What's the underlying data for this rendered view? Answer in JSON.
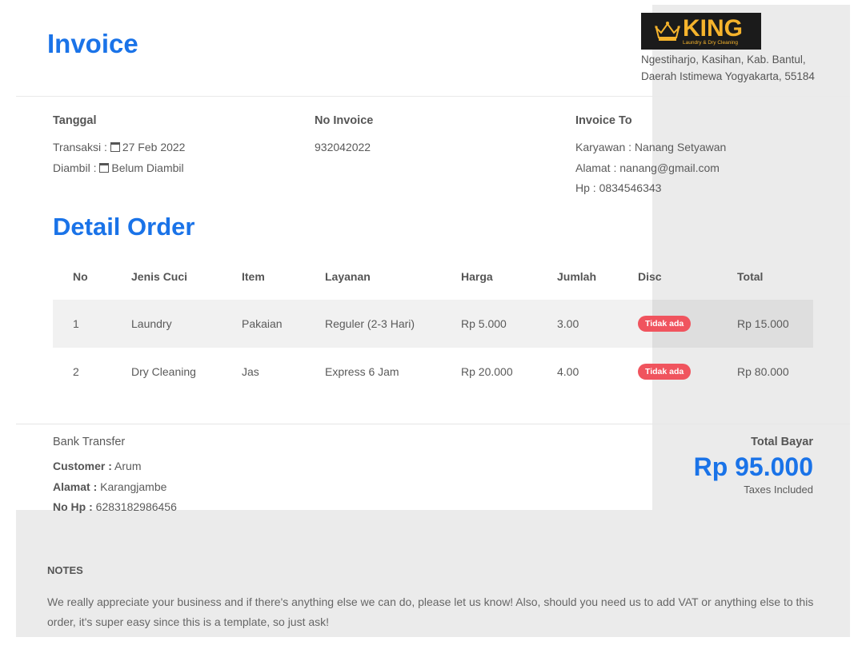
{
  "invoice": {
    "title": "Invoice",
    "logo": {
      "name": "KING",
      "tagline": "Laundry & Dry Cleaning"
    },
    "address": {
      "line1": "Ngestiharjo, Kasihan, Kab. Bantul,",
      "line2": "Daerah Istimewa Yogyakarta, 55184"
    },
    "tanggal": {
      "heading": "Tanggal",
      "transaksi_label": "Transaksi :",
      "transaksi_value": "27 Feb 2022",
      "diambil_label": "Diambil :",
      "diambil_value": "Belum Diambil"
    },
    "no_invoice": {
      "heading": "No Invoice",
      "value": "932042022"
    },
    "invoice_to": {
      "heading": "Invoice To",
      "karyawan": "Karyawan : Nanang Setyawan",
      "alamat": "Alamat : nanang@gmail.com",
      "hp": "Hp : 0834546343"
    }
  },
  "order": {
    "title": "Detail Order",
    "columns": [
      "No",
      "Jenis Cuci",
      "Item",
      "Layanan",
      "Harga",
      "Jumlah",
      "Disc",
      "Total"
    ],
    "rows": [
      {
        "no": "1",
        "jenis": "Laundry",
        "item": "Pakaian",
        "layanan": "Reguler (2-3 Hari)",
        "harga": "Rp 5.000",
        "jumlah": "3.00",
        "disc": "Tidak ada",
        "total": "Rp 15.000"
      },
      {
        "no": "2",
        "jenis": "Dry Cleaning",
        "item": "Jas",
        "layanan": "Express 6 Jam",
        "harga": "Rp 20.000",
        "jumlah": "4.00",
        "disc": "Tidak ada",
        "total": "Rp 80.000"
      }
    ]
  },
  "payment": {
    "method": "Bank Transfer",
    "customer_label": "Customer :",
    "customer_value": "Arum",
    "alamat_label": "Alamat :",
    "alamat_value": "Karangjambe",
    "hp_label": "No Hp :",
    "hp_value": "6283182986456"
  },
  "total": {
    "label": "Total Bayar",
    "amount": "Rp 95.000",
    "note": "Taxes Included"
  },
  "notes": {
    "heading": "NOTES",
    "text": "We really appreciate your business and if there's anything else we can do, please let us know! Also, should you need us to add VAT or anything else to this order, it's super easy since this is a template, so just ask!"
  },
  "colors": {
    "accent": "#1a73e8",
    "badge": "#f0545e",
    "logo_bg": "#1b1b1b",
    "logo_gold": "#f5b32c"
  }
}
